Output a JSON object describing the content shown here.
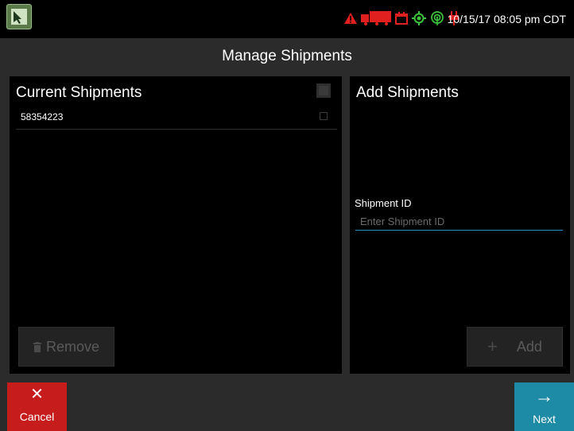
{
  "status_bar": {
    "datetime": "10/15/17 08:05 pm CDT",
    "icons": [
      "app-icon",
      "warning-icon",
      "truck-icon",
      "calendar-icon",
      "gps-icon",
      "signal-icon",
      "power-plug-icon"
    ],
    "alert_color": "#e0201f",
    "ok_color": "#3ec13e"
  },
  "header": {
    "title": "Manage Shipments"
  },
  "current_shipments": {
    "title": "Current Shipments",
    "items": [
      {
        "id": "58354223"
      }
    ],
    "remove_label": "Remove"
  },
  "add_shipments": {
    "title": "Add Shipments",
    "field_label": "Shipment ID",
    "field_placeholder": "Enter Shipment ID",
    "field_value": "",
    "add_label": "Add"
  },
  "footer": {
    "cancel_label": "Cancel",
    "next_label": "Next",
    "cancel_color": "#c71c1c",
    "next_color": "#1d8aa6"
  }
}
